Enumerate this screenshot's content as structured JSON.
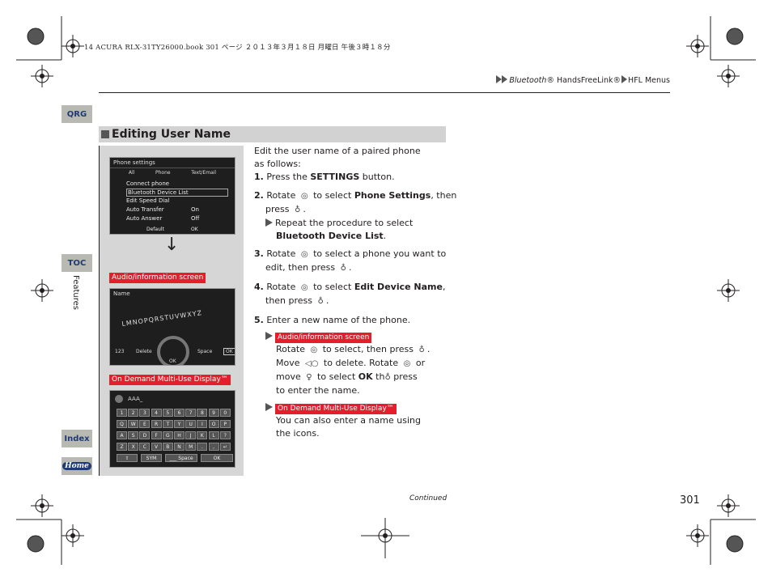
{
  "print_header": "14 ACURA RLX-31TY26000.book  301 ページ  ２０１３年３月１８日  月曜日  午後３時１８分",
  "breadcrumb": {
    "part1": "Bluetooth",
    "part2": "® HandsFreeLink®",
    "part3": "HFL Menus"
  },
  "nav": {
    "qrg": "QRG",
    "toc": "TOC",
    "index": "Index",
    "home": "Home",
    "section": "Features"
  },
  "section_title": "Editing User Name",
  "screens": {
    "phone_settings": {
      "title": "Phone settings",
      "tabs": [
        "All",
        "Phone",
        "Text/Email"
      ],
      "items": [
        {
          "label": "Connect phone",
          "value": ""
        },
        {
          "label": "Bluetooth Device List",
          "value": ""
        },
        {
          "label": "Edit Speed Dial",
          "value": ""
        },
        {
          "label": "Auto Transfer",
          "value": "On"
        },
        {
          "label": "Auto Answer",
          "value": "Off"
        }
      ],
      "footer": [
        "Default",
        "OK"
      ]
    },
    "label_audio": "Audio/information screen",
    "name_entry": {
      "title": "Name",
      "letters": "LMNOPQRSTUVWXYZ",
      "left": "123",
      "delete": "Delete",
      "space": "Space",
      "ok": "OK"
    },
    "label_odmd": "On Demand Multi-Use Display™",
    "keyboard": {
      "value": "AAA_",
      "rows": [
        [
          "1",
          "2",
          "3",
          "4",
          "5",
          "6",
          "7",
          "8",
          "9",
          "0"
        ],
        [
          "Q",
          "W",
          "E",
          "R",
          "T",
          "Y",
          "U",
          "I",
          "O",
          "P"
        ],
        [
          "A",
          "S",
          "D",
          "F",
          "G",
          "H",
          "J",
          "K",
          "L",
          "?"
        ],
        [
          "Z",
          "X",
          "C",
          "V",
          "B",
          "N",
          "M",
          ".",
          ",",
          "↵"
        ]
      ],
      "bottom": [
        "⇧",
        "SYM",
        "___ Space",
        "OK"
      ]
    }
  },
  "instructions": {
    "intro1": "Edit the user name of a paired phone",
    "intro2": "as follows:",
    "s1": {
      "n": "1.",
      "a": "Press the ",
      "b": "SETTINGS",
      "c": " button."
    },
    "s2": {
      "n": "2.",
      "a": "Rotate ",
      "b": " to select ",
      "bold": "Phone Settings",
      "c": ", then",
      "d": "press ",
      "e": ".",
      "sub1": "Repeat the procedure to select",
      "sub2": "Bluetooth Device List",
      "sub3": "."
    },
    "s3": {
      "n": "3.",
      "a": "Rotate ",
      "b": " to select a phone you want to",
      "c": "edit, then press ",
      "d": "."
    },
    "s4": {
      "n": "4.",
      "a": "Rotate ",
      "b": " to select ",
      "bold": "Edit Device Name",
      "c": ",",
      "d": "then press ",
      "e": "."
    },
    "s5": {
      "n": "5.",
      "a": "Enter a new name of the phone."
    },
    "audio_label": "Audio/information screen",
    "audio1a": "Rotate ",
    "audio1b": " to select, then press ",
    "audio1c": ".",
    "audio2a": "Move ",
    "audio2b": " to delete. Rotate ",
    "audio2c": " or",
    "audio3a": "move ",
    "audio3b": " to select ",
    "audio3ok": "OK",
    "audio3c": " th",
    "audio3d": " press",
    "audio4": "to enter the  name.",
    "odmd_label": "On Demand Multi-Use Display™",
    "odmd1": "You can also enter a name using",
    "odmd2": "the icons."
  },
  "continued": "Continued",
  "page_number": "301",
  "colors": {
    "red_label": "#e41e2b",
    "nav_tab": "#b9b9b3",
    "nav_text": "#1f3b73",
    "section_bar": "#d2d2d2"
  }
}
